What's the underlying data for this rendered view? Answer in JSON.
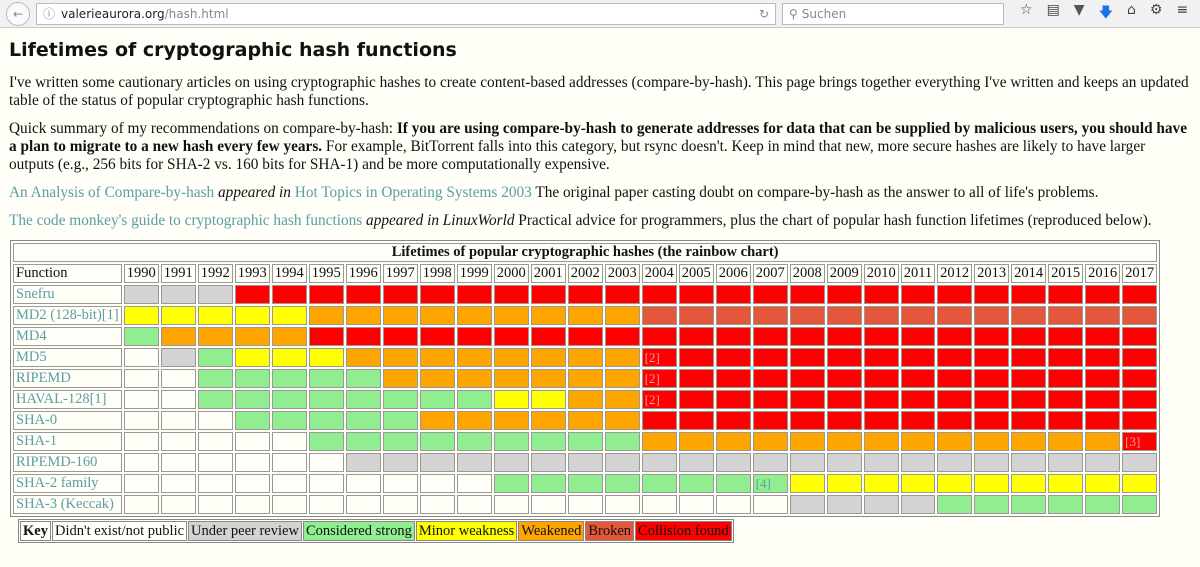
{
  "browser": {
    "url_domain": "valerieaurora.org",
    "url_path": "/hash.html",
    "search_placeholder": "Suchen"
  },
  "title": "Lifetimes of cryptographic hash functions",
  "intro": "I've written some cautionary articles on using cryptographic hashes to create content-based addresses (compare-by-hash). This page brings together everything I've written and keeps an updated table of the status of popular cryptographic hash functions.",
  "summary": {
    "lead": "Quick summary of my recommendations on compare-by-hash: ",
    "bold": "If you are using compare-by-hash to generate addresses for data that can be supplied by malicious users, you should have a plan to migrate to a new hash every few years.",
    "rest": " For example, BitTorrent falls into this category, but rsync doesn't. Keep in mind that new, more secure hashes are likely to have larger outputs (e.g., 256 bits for SHA-2 vs. 160 bits for SHA-1) and be more computationally expensive."
  },
  "article1": {
    "link": "An Analysis of Compare-by-hash",
    "appeared": " appeared in ",
    "venue": "Hot Topics in Operating Systems 2003",
    "desc": " The original paper casting doubt on compare-by-hash as the answer to all of life's problems."
  },
  "article2": {
    "link": "The code monkey's guide to cryptographic hash functions",
    "appeared": " appeared in LinuxWorld",
    "desc": " Practical advice for programmers, plus the chart of popular hash function lifetimes (reproduced below)."
  },
  "chart": {
    "caption": "Lifetimes of popular cryptographic hashes (the rainbow chart)",
    "function_header": "Function",
    "years": [
      "1990",
      "1991",
      "1992",
      "1993",
      "1994",
      "1995",
      "1996",
      "1997",
      "1998",
      "1999",
      "2000",
      "2001",
      "2002",
      "2003",
      "2004",
      "2005",
      "2006",
      "2007",
      "2008",
      "2009",
      "2010",
      "2011",
      "2012",
      "2013",
      "2014",
      "2015",
      "2016",
      "2017"
    ],
    "colors": {
      "n": "#fffff8",
      "p": "#d3d3d3",
      "s": "#90ee90",
      "m": "#ffff00",
      "w": "#ffa500",
      "b": "#e3573b",
      "c": "#ff0000"
    },
    "rows": [
      {
        "name": "Snefru",
        "status": "pppccccccccccccccccccccccccc",
        "notes": {}
      },
      {
        "name": "MD2 (128-bit)[1]",
        "status": "mmmmmwwwwwwwwwbbbbbbbbbbbbbb",
        "notes": {}
      },
      {
        "name": "MD4",
        "status": "swwwwccccccccccccccccccccccc",
        "notes": {}
      },
      {
        "name": "MD5",
        "status": "npsmmmwwwwwwwwcccccccccccccc",
        "notes": {
          "2004": "[2]"
        }
      },
      {
        "name": "RIPEMD",
        "status": "nnssssswwwwwwwcccccccccccccc",
        "notes": {
          "2004": "[2]"
        }
      },
      {
        "name": "HAVAL-128[1]",
        "status": "nnssssssssmmwwcccccccccccccc",
        "notes": {
          "2004": "[2]"
        }
      },
      {
        "name": "SHA-0",
        "status": "nnnssssswwwwwwcccccccccccccc",
        "notes": {}
      },
      {
        "name": "SHA-1",
        "status": "nnnnnssssssssswwwwwwwwwwwwwc",
        "notes": {
          "2017": "[3]"
        }
      },
      {
        "name": "RIPEMD-160",
        "status": "nnnnnnpppppppppppppppppppppp",
        "notes": {}
      },
      {
        "name": "SHA-2 family",
        "status": "nnnnnnnnnnssssssssmmmmmmmmmm",
        "notes": {
          "2007": "[4]"
        }
      },
      {
        "name": "SHA-3 (Keccak)",
        "status": "nnnnnnnnnnnnnnnnnnppppssssss",
        "notes": {}
      }
    ]
  },
  "key": {
    "label": "Key",
    "items": [
      {
        "code": "n",
        "label": "Didn't exist/not public"
      },
      {
        "code": "p",
        "label": "Under peer review"
      },
      {
        "code": "s",
        "label": "Considered strong"
      },
      {
        "code": "m",
        "label": "Minor weakness"
      },
      {
        "code": "w",
        "label": "Weakened"
      },
      {
        "code": "b",
        "label": "Broken"
      },
      {
        "code": "c",
        "label": "Collision found"
      }
    ]
  }
}
